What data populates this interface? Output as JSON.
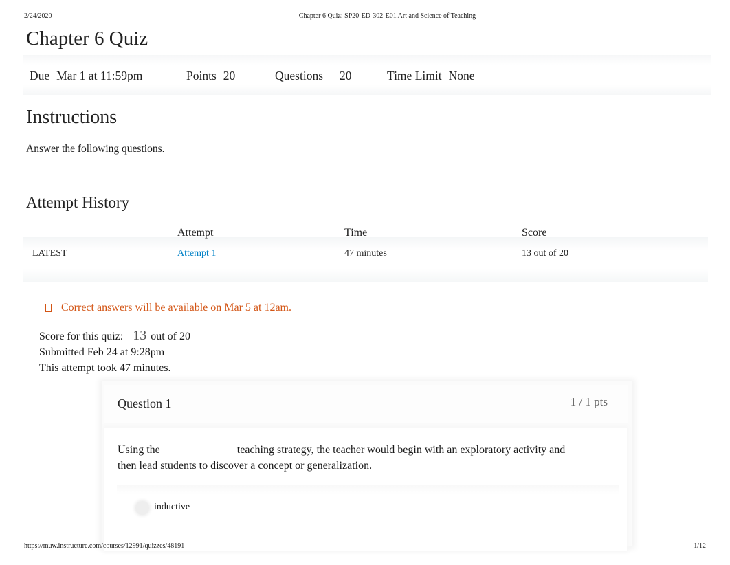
{
  "print_header": {
    "date": "2/24/2020",
    "title": "Chapter 6 Quiz: SP20-ED-302-E01 Art and Science of Teaching"
  },
  "quiz": {
    "title": "Chapter 6 Quiz",
    "meta": {
      "due_label": "Due",
      "due_value": "Mar 1 at 11:59pm",
      "points_label": "Points",
      "points_value": "20",
      "questions_label": "Questions",
      "questions_value": "20",
      "time_limit_label": "Time Limit",
      "time_limit_value": "None"
    },
    "instructions_title": "Instructions",
    "instructions_text": "Answer the following questions."
  },
  "attempt_history": {
    "title": "Attempt History",
    "columns": [
      "",
      "Attempt",
      "Time",
      "Score"
    ],
    "rows": [
      {
        "tag": "LATEST",
        "attempt": "Attempt 1",
        "time": "47 minutes",
        "score": "13 out of 20"
      }
    ]
  },
  "result": {
    "notice_icon": "info-icon",
    "notice": "Correct answers will be available on Mar 5 at 12am.",
    "score_label": "Score for this quiz:",
    "score_value": "13",
    "score_suffix": "out of 20",
    "submitted": "Submitted Feb 24 at 9:28pm",
    "duration": "This attempt took 47 minutes."
  },
  "questions": [
    {
      "title": "Question 1",
      "points": "1 / 1 pts",
      "text": "Using the _____________ teaching strategy, the teacher would begin with an exploratory activity and then lead students to discover a concept or generalization.",
      "answers": [
        {
          "label": "inductive"
        }
      ]
    }
  ],
  "print_footer": {
    "url": "https://muw.instructure.com/courses/12991/quizzes/48191",
    "page": "1/12"
  },
  "colors": {
    "link": "#0081c6",
    "notice": "#d35515"
  }
}
